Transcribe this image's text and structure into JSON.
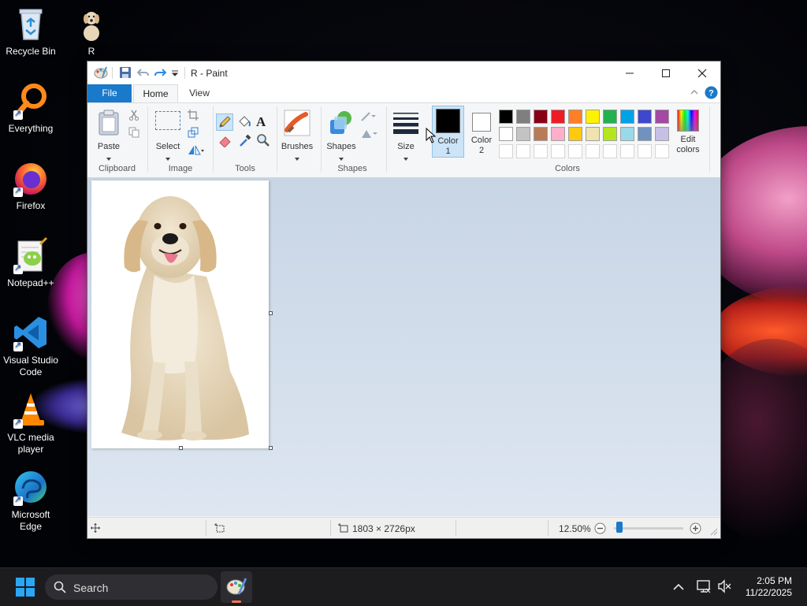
{
  "desktop": {
    "icons": [
      {
        "label": "Recycle Bin"
      },
      {
        "label": "R"
      },
      {
        "label": "Everything"
      },
      {
        "label": "Firefox"
      },
      {
        "label": "Notepad++"
      },
      {
        "label": "Visual Studio Code"
      },
      {
        "label": "VLC media player"
      },
      {
        "label": "Microsoft Edge"
      }
    ]
  },
  "window": {
    "title": "R - Paint",
    "tabs": {
      "file": "File",
      "home": "Home",
      "view": "View"
    },
    "ribbon": {
      "paste": "Paste",
      "select": "Select",
      "brushes": "Brushes",
      "shapes": "Shapes",
      "size": "Size",
      "color1": "Color\n1",
      "color2": "Color\n2",
      "edit_colors": "Edit\ncolors",
      "groups": {
        "clipboard": "Clipboard",
        "image": "Image",
        "tools": "Tools",
        "shapes": "Shapes",
        "colors": "Colors"
      }
    },
    "palette_row1": [
      "#000000",
      "#7f7f7f",
      "#880015",
      "#ed1c24",
      "#ff7f27",
      "#fff200",
      "#22b14c",
      "#00a2e8",
      "#3f48cc",
      "#a349a4"
    ],
    "palette_row2": [
      "#ffffff",
      "#c3c3c3",
      "#b97a57",
      "#ffaec9",
      "#ffc90e",
      "#efe4b0",
      "#b5e61d",
      "#99d9ea",
      "#7092be",
      "#c8bfe7"
    ],
    "color1_value": "#000000",
    "color2_value": "#ffffff",
    "status": {
      "dimensions": "1803 × 2726px",
      "zoom": "12.50%",
      "zoom_level": 0.125
    }
  },
  "taskbar": {
    "search_placeholder": "Search",
    "time": "2:05 PM",
    "date": "11/22/2025"
  },
  "colors": {
    "accent": "#1979ca",
    "ribbon_bg": "#f5f6f7",
    "canvas_bg": "#c8d5e5"
  }
}
